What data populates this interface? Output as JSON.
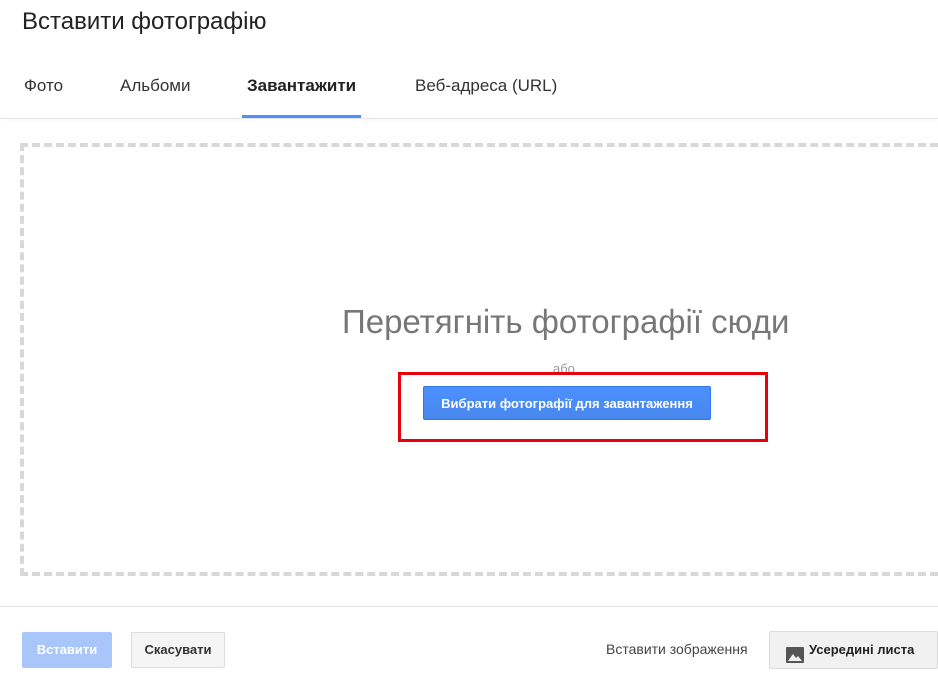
{
  "dialog": {
    "title": "Вставити фотографію"
  },
  "tabs": [
    {
      "label": "Фото",
      "active": false
    },
    {
      "label": "Альбоми",
      "active": false
    },
    {
      "label": "Завантажити",
      "active": true
    },
    {
      "label": "Веб-адреса (URL)",
      "active": false
    }
  ],
  "upload": {
    "drop_text": "Перетягніть фотографії сюди",
    "or_text": "або",
    "select_button": "Вибрати фотографії для завантаження"
  },
  "footer": {
    "insert_button": "Вставити",
    "cancel_button": "Скасувати",
    "insert_image_label": "Вставити зображення",
    "inside_sheet_button": "Усередині листа",
    "inside_sheet_icon": "image-icon"
  },
  "colors": {
    "accent": "#4d90fe",
    "highlight": "#e8000d",
    "disabled_button": "#a8c6fa"
  }
}
